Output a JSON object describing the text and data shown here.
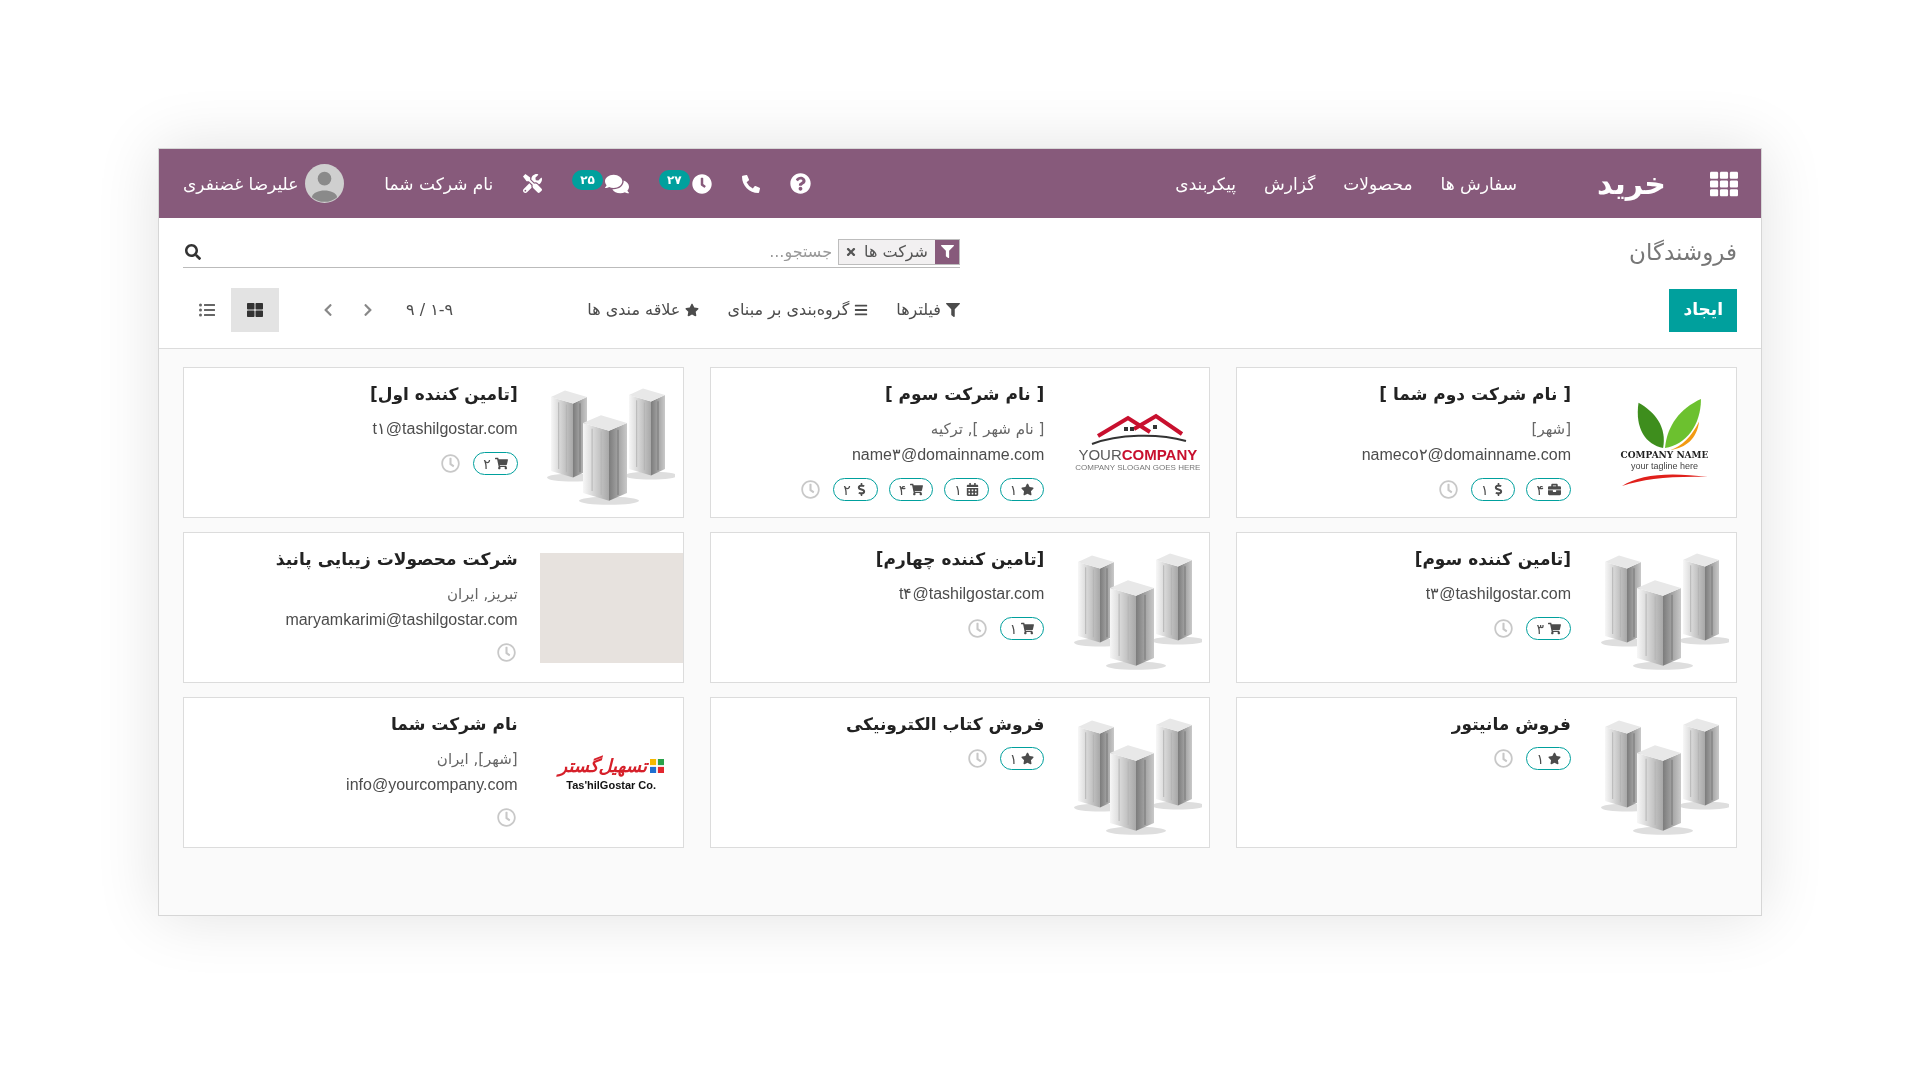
{
  "navbar": {
    "app_name": "خرید",
    "menu": [
      "سفارش ها",
      "محصولات",
      "گزارش",
      "پیکربندی"
    ],
    "activity_count": "۲۷",
    "message_count": "۲۵",
    "company": "نام شرکت شما",
    "user": "علیرضا غضنفری"
  },
  "breadcrumb": "فروشندگان",
  "search": {
    "facet": "شرکت ها",
    "placeholder": "جستجو..."
  },
  "create_button": "ایجاد",
  "search_options": [
    {
      "kind": "filter",
      "label": "فیلترها"
    },
    {
      "kind": "group",
      "label": "گروه‌بندی بر مبنای"
    },
    {
      "kind": "favorite",
      "label": "علاقه مندی ها"
    }
  ],
  "pager": "۱-۹ / ۹",
  "views": [
    {
      "kind": "kanban",
      "selected": true
    },
    {
      "kind": "list",
      "selected": false
    }
  ],
  "cards": [
    {
      "image": {
        "kind": "leaf-logo",
        "name": "COMPANY NAME",
        "tagline": "your tagline here"
      },
      "title": "[ نام شرکت دوم شما ]",
      "address": "[شهر]",
      "email": "nameco۲@domainname.com",
      "badges": [
        {
          "kind": "briefcase",
          "count": "۴"
        },
        {
          "kind": "dollar",
          "count": "۱"
        }
      ]
    },
    {
      "image": {
        "kind": "house-logo",
        "name": "YOUR**COMPANY**",
        "tagline": "COMPANY SLOGAN GOES HERE"
      },
      "title": "[ نام شرکت سوم ]",
      "address": "[ نام شهر ], ترکیه",
      "email": "name۳@domainname.com",
      "badges": [
        {
          "kind": "star",
          "count": "۱"
        },
        {
          "kind": "calendar",
          "count": "۱"
        },
        {
          "kind": "cart",
          "count": "۴"
        },
        {
          "kind": "dollar",
          "count": "۲"
        }
      ]
    },
    {
      "image": {
        "kind": "buildings"
      },
      "title": "[تامین کننده اول]",
      "email": "t۱@tashilgostar.com",
      "badges": [
        {
          "kind": "cart",
          "count": "۲"
        }
      ]
    },
    {
      "image": {
        "kind": "buildings"
      },
      "title": "[تامین کننده سوم]",
      "email": "t۳@tashilgostar.com",
      "badges": [
        {
          "kind": "cart",
          "count": "۳"
        }
      ]
    },
    {
      "image": {
        "kind": "buildings"
      },
      "title": "[تامین کننده چهارم]",
      "email": "t۴@tashilgostar.com",
      "badges": [
        {
          "kind": "cart",
          "count": "۱"
        }
      ]
    },
    {
      "image": {
        "kind": "photo"
      },
      "title": "شرکت محصولات زیبایی پانیذ",
      "address": "تبریز, ایران",
      "email": "maryamkarimi@tashilgostar.com"
    },
    {
      "image": {
        "kind": "buildings"
      },
      "title": "فروش مانیتور",
      "badges": [
        {
          "kind": "star",
          "count": "۱"
        }
      ]
    },
    {
      "image": {
        "kind": "buildings"
      },
      "title": "فروش کتاب الکترونیکی",
      "badges": [
        {
          "kind": "star",
          "count": "۱"
        }
      ]
    },
    {
      "image": {
        "kind": "tashil-logo",
        "name": "تسهیل‌گستر",
        "tagline": "Tas'hilGostar Co."
      },
      "title": "نام شرکت شما",
      "address": "[شهر], ایران",
      "email": "info@yourcompany.com"
    }
  ]
}
